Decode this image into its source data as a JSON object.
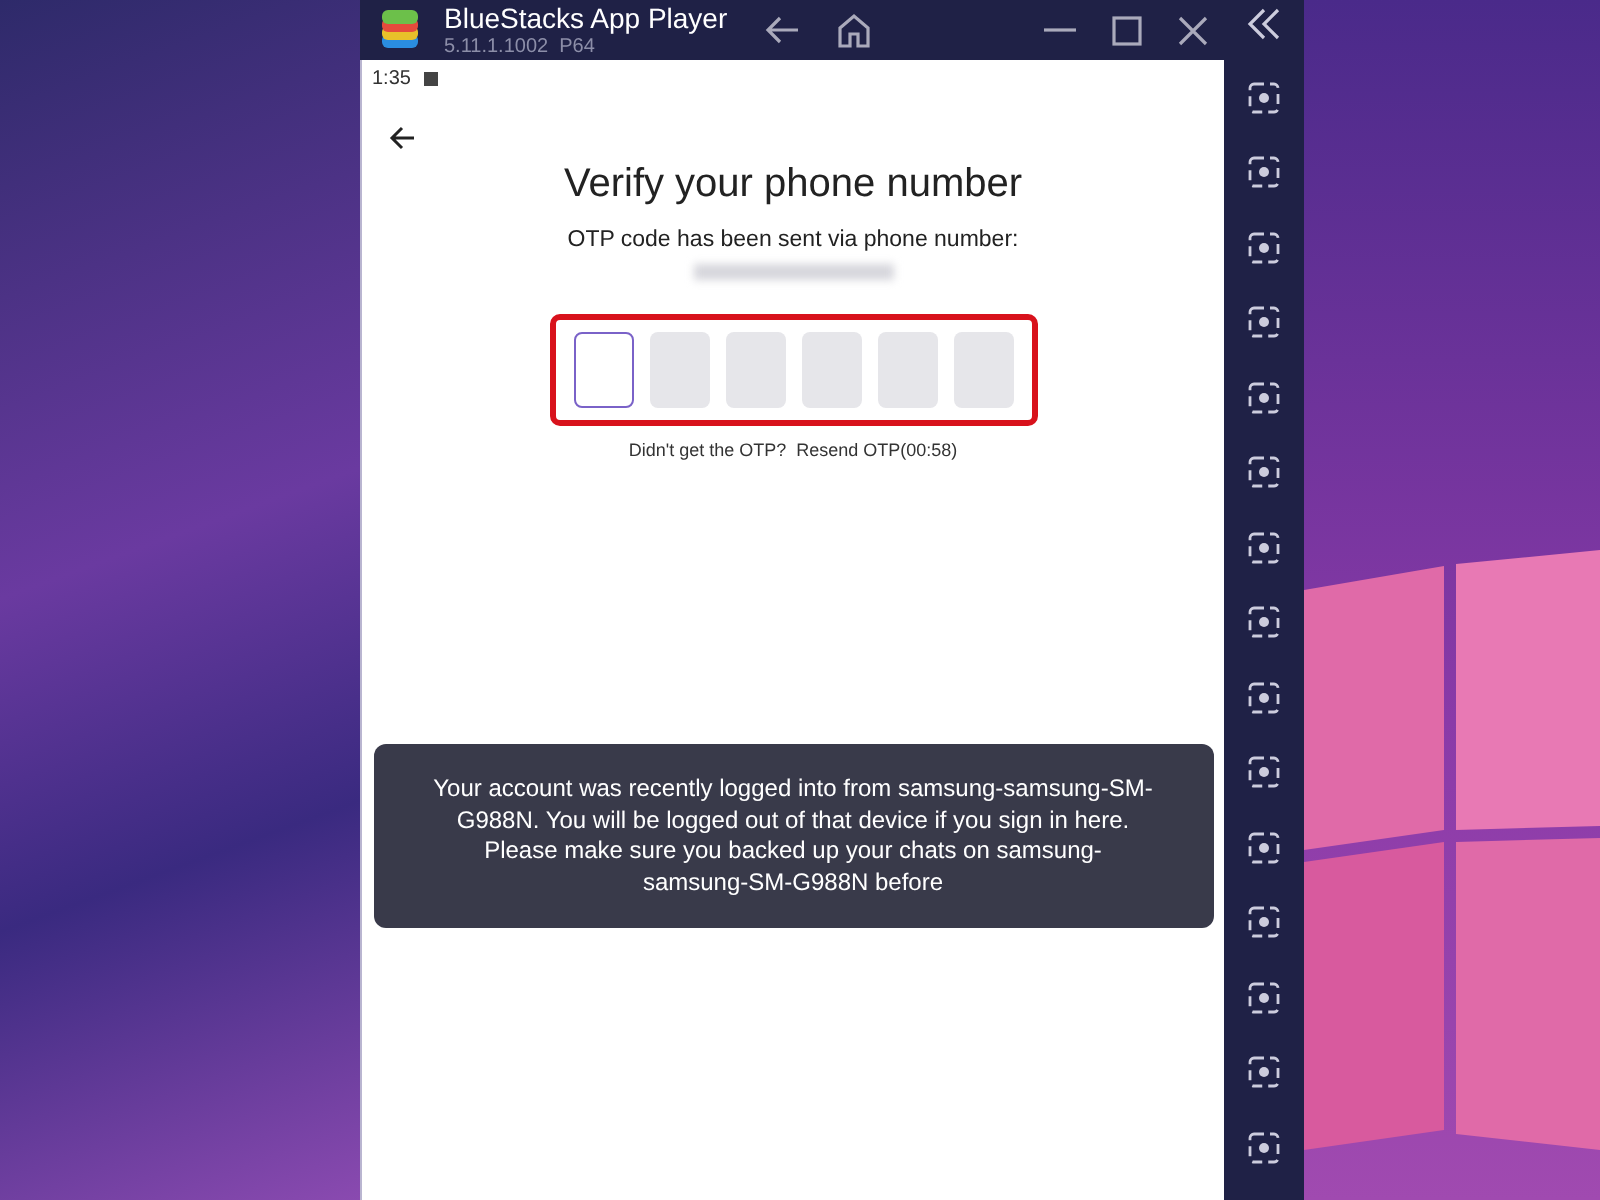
{
  "window": {
    "title": "BlueStacks App Player",
    "version": "5.11.1.1002  P64"
  },
  "status_bar": {
    "time": "1:35"
  },
  "screen": {
    "title": "Verify your phone number",
    "subtitle": "OTP code has been sent via phone number:",
    "otp_boxes": [
      {
        "selected": true
      },
      {
        "selected": false
      },
      {
        "selected": false
      },
      {
        "selected": false
      },
      {
        "selected": false
      },
      {
        "selected": false
      }
    ],
    "resend_prompt": "Didn't get the OTP?",
    "resend_link": "Resend OTP(00:58)"
  },
  "toast": {
    "message": "Your account was recently logged into from samsung-samsung-SM-G988N. You will be logged out of that device if you sign in here. Please make sure you backed up your chats on samsung-samsung-SM-G988N before"
  }
}
